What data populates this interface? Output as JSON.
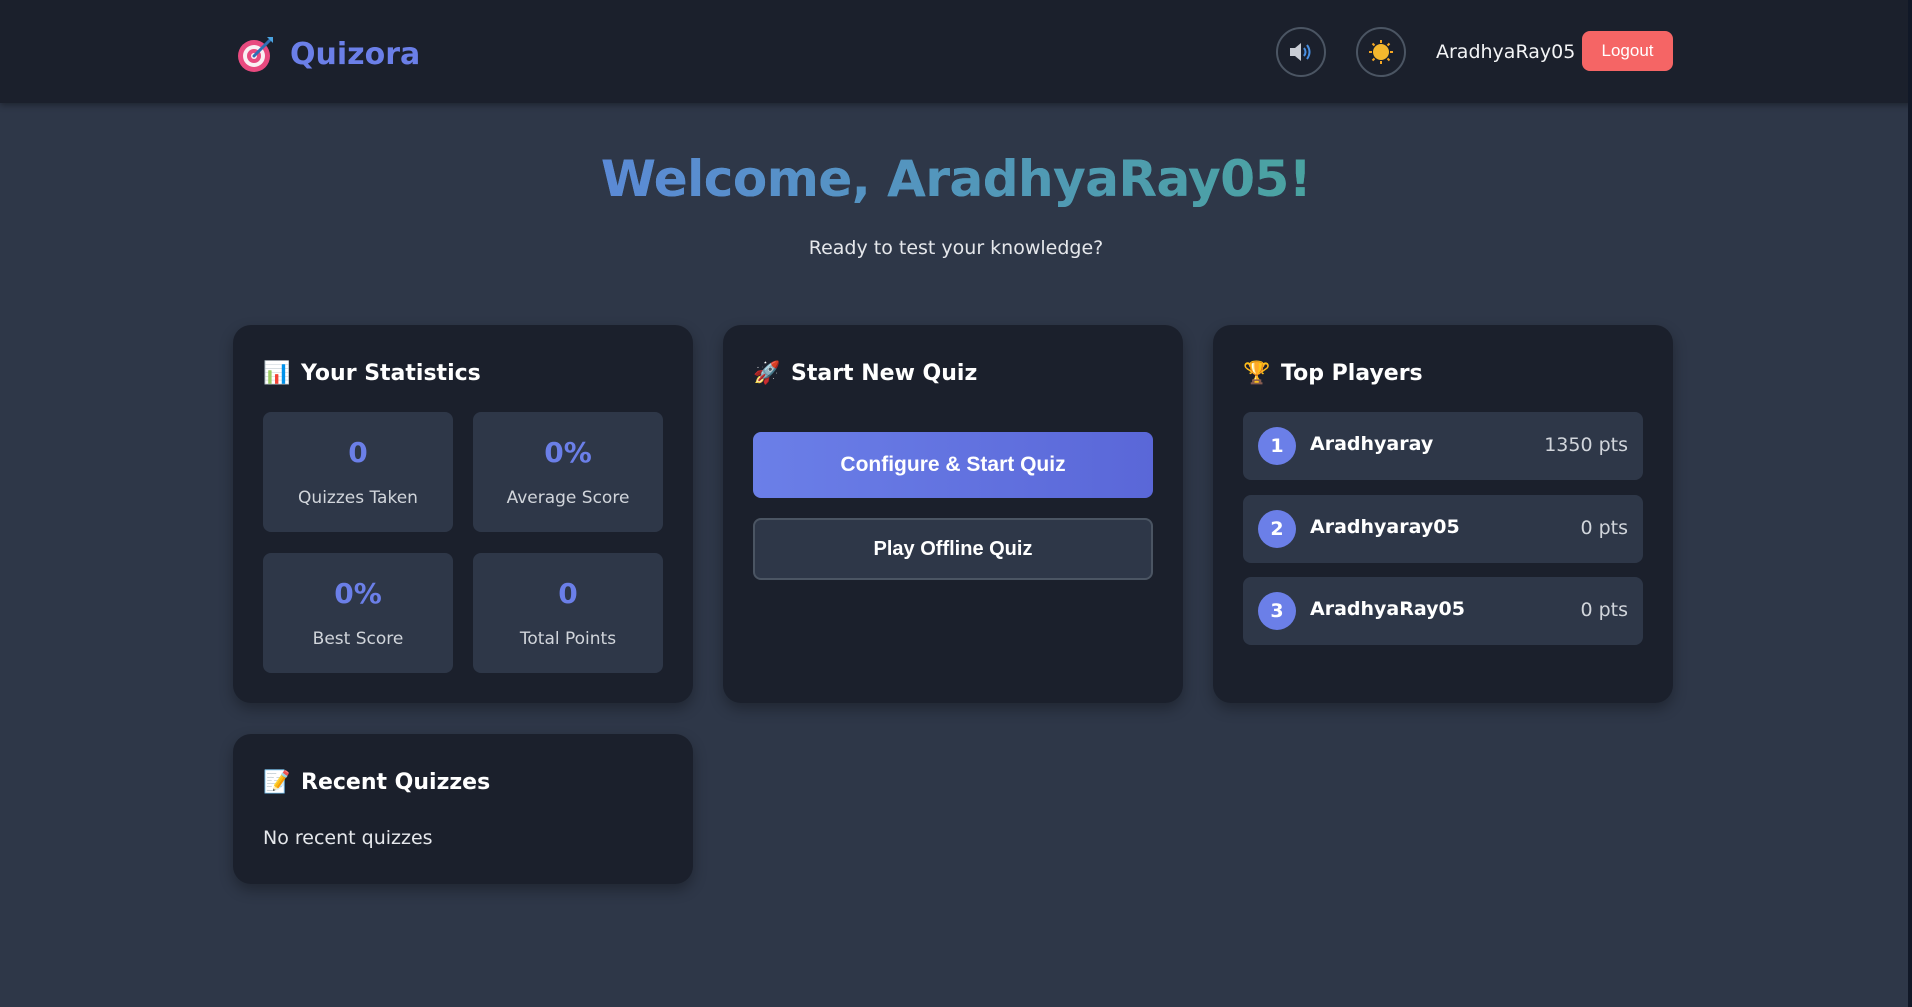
{
  "header": {
    "logo_icon": "target-dart-icon",
    "app_name": "Quizora",
    "sound_icon": "speaker-icon",
    "theme_icon": "sun-icon",
    "username": "AradhyaRay05",
    "logout_label": "Logout"
  },
  "welcome": {
    "title": "Welcome, AradhyaRay05!",
    "subtitle": "Ready to test your knowledge?"
  },
  "stats": {
    "emoji": "📊",
    "title": "Your Statistics",
    "items": [
      {
        "value": "0",
        "label": "Quizzes Taken"
      },
      {
        "value": "0%",
        "label": "Average Score"
      },
      {
        "value": "0%",
        "label": "Best Score"
      },
      {
        "value": "0",
        "label": "Total Points"
      }
    ]
  },
  "quiz": {
    "emoji": "🚀",
    "title": "Start New Quiz",
    "primary_label": "Configure & Start Quiz",
    "secondary_label": "Play Offline Quiz"
  },
  "players": {
    "emoji": "🏆",
    "title": "Top Players",
    "list": [
      {
        "rank": "1",
        "name": "Aradhyaray",
        "points": "1350 pts"
      },
      {
        "rank": "2",
        "name": "Aradhyaray05",
        "points": "0 pts"
      },
      {
        "rank": "3",
        "name": "AradhyaRay05",
        "points": "0 pts"
      }
    ]
  },
  "recent": {
    "emoji": "📝",
    "title": "Recent Quizzes",
    "empty_text": "No recent quizzes"
  },
  "colors": {
    "accent": "#6b7fe8",
    "logout": "#f56565",
    "background": "#2e3748",
    "card": "#1b202c"
  }
}
